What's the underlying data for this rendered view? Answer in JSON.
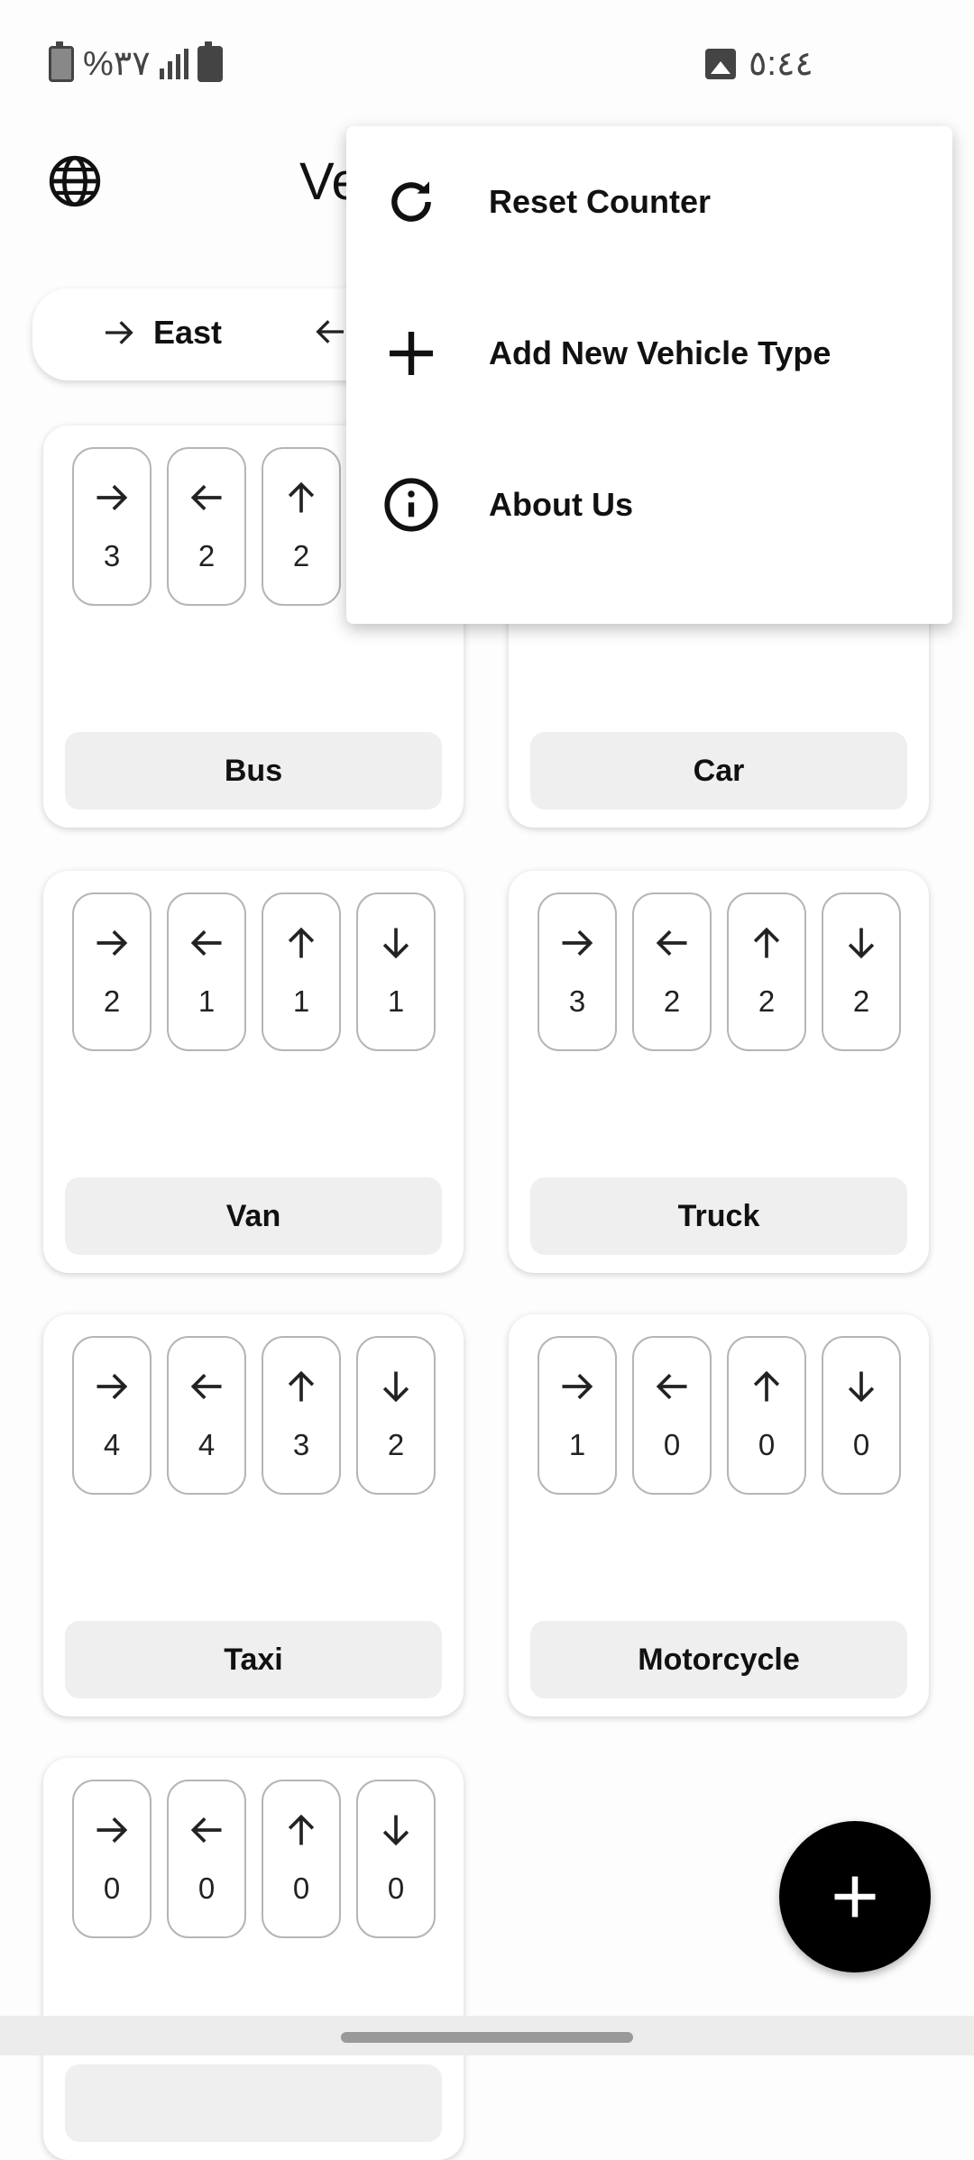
{
  "status_bar": {
    "battery_text": "%٣٧",
    "time": "٥:٤٤"
  },
  "app_bar": {
    "title": "Ve",
    "globe_icon": "globe-icon"
  },
  "direction_selector": {
    "options": [
      {
        "label": "East",
        "icon": "arrow-right-icon"
      },
      {
        "label": "",
        "icon": "arrow-left-icon"
      }
    ]
  },
  "cards": [
    {
      "label": "Bus",
      "counts": {
        "right": "3",
        "left": "2",
        "up": "2",
        "down": ""
      }
    },
    {
      "label": "Car",
      "counts": {
        "right": "",
        "left": "",
        "up": "",
        "down": ""
      }
    },
    {
      "label": "Van",
      "counts": {
        "right": "2",
        "left": "1",
        "up": "1",
        "down": "1"
      }
    },
    {
      "label": "Truck",
      "counts": {
        "right": "3",
        "left": "2",
        "up": "2",
        "down": "2"
      }
    },
    {
      "label": "Taxi",
      "counts": {
        "right": "4",
        "left": "4",
        "up": "3",
        "down": "2"
      }
    },
    {
      "label": "Motorcycle",
      "counts": {
        "right": "1",
        "left": "0",
        "up": "0",
        "down": "0"
      }
    },
    {
      "label": "",
      "counts": {
        "right": "0",
        "left": "0",
        "up": "0",
        "down": "0"
      }
    }
  ],
  "menu": {
    "items": [
      {
        "label": "Reset Counter",
        "icon": "refresh-icon"
      },
      {
        "label": "Add New Vehicle Type",
        "icon": "plus-icon"
      },
      {
        "label": "About Us",
        "icon": "info-icon"
      }
    ]
  },
  "fab": {
    "icon": "plus-icon"
  }
}
